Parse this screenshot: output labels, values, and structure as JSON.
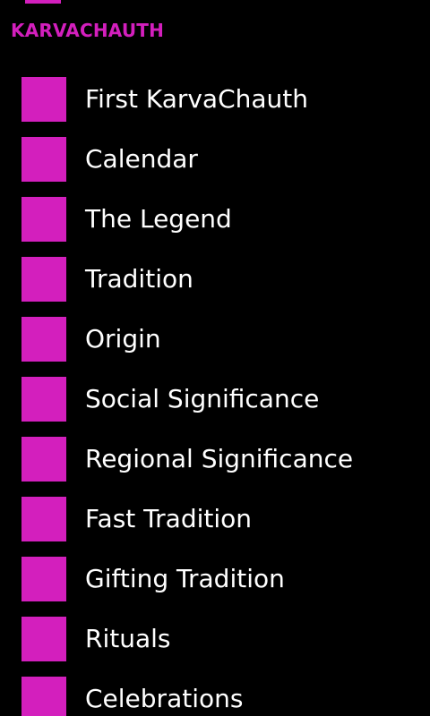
{
  "app": {
    "title": "KARVACHAUTH",
    "accent_color": "#d31fbd"
  },
  "menu": {
    "items": [
      {
        "label": "First KarvaChauth"
      },
      {
        "label": "Calendar"
      },
      {
        "label": "The Legend"
      },
      {
        "label": "Tradition"
      },
      {
        "label": "Origin"
      },
      {
        "label": "Social Significance"
      },
      {
        "label": "Regional Significance"
      },
      {
        "label": "Fast Tradition"
      },
      {
        "label": "Gifting Tradition"
      },
      {
        "label": "Rituals"
      },
      {
        "label": "Celebrations"
      }
    ]
  }
}
